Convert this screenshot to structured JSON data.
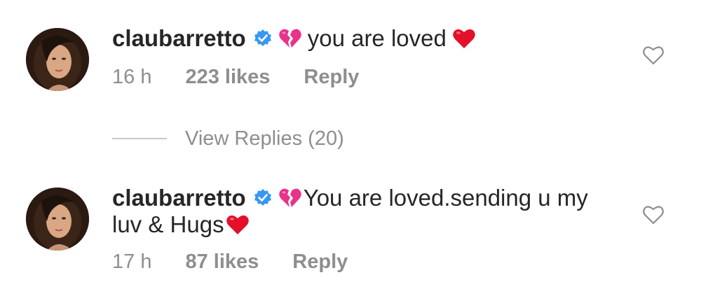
{
  "comments": [
    {
      "username": "claubarretto",
      "text": "you are loved",
      "time": "16 h",
      "likes": "223 likes",
      "reply_label": "Reply"
    },
    {
      "username": "claubarretto",
      "text_part1": "You are loved.sending u my",
      "text_part2": "luv & Hugs",
      "time": "17 h",
      "likes": "87 likes",
      "reply_label": "Reply"
    }
  ],
  "view_replies_label": "View Replies (20)",
  "icons": {
    "verified": "verified-badge-icon",
    "broken_heart": "broken-heart-emoji",
    "red_heart": "red-heart-emoji",
    "like": "heart-outline-icon"
  },
  "colors": {
    "verified_blue": "#3897f0",
    "broken_heart_pink": "#e8338a",
    "heart_red": "#e4102a",
    "meta_gray": "#8e8e8e"
  }
}
